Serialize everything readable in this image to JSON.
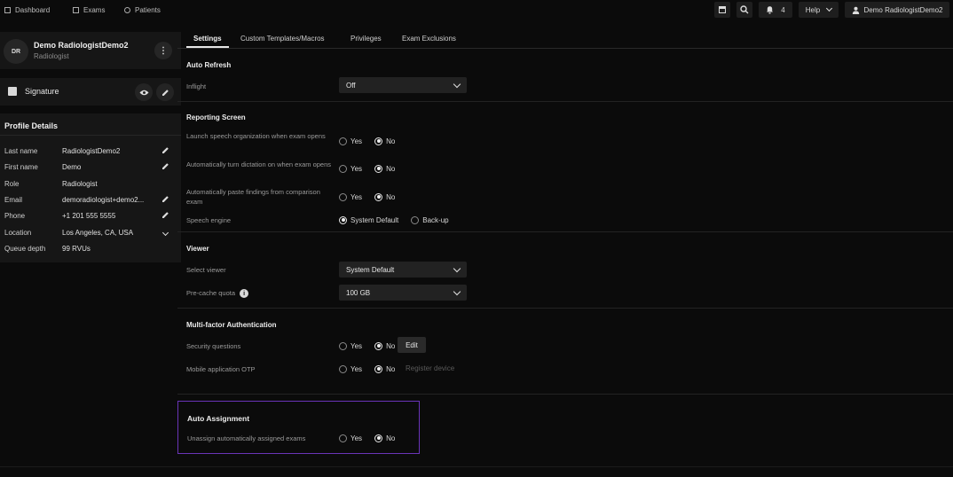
{
  "nav": {
    "dashboard": "Dashboard",
    "exams": "Exams",
    "patients": "Patients",
    "notifications_count": "4",
    "help": "Help",
    "user": "Demo RadiologistDemo2"
  },
  "profile": {
    "initials": "DR",
    "name": "Demo RadiologistDemo2",
    "role": "Radiologist",
    "signature_label": "Signature",
    "details_title": "Profile Details",
    "details": [
      {
        "label": "Last name",
        "value": "RadiologistDemo2",
        "action": "edit-icon"
      },
      {
        "label": "First name",
        "value": "Demo",
        "action": "edit-icon"
      },
      {
        "label": "Role",
        "value": "Radiologist",
        "action": ""
      },
      {
        "label": "Email",
        "value": "demoradiologist+demo2...",
        "action": "edit-icon"
      },
      {
        "label": "Phone",
        "value": "+1 201 555 5555",
        "action": "edit-icon"
      },
      {
        "label": "Location",
        "value": "Los Angeles, CA, USA",
        "action": "chevron-down-icon"
      },
      {
        "label": "Queue depth",
        "value": "99 RVUs",
        "action": ""
      }
    ]
  },
  "tabs": [
    "Settings",
    "Custom Templates/Macros",
    "Privileges",
    "Exam Exclusions"
  ],
  "active_tab": "Settings",
  "sections": {
    "auto_refresh": {
      "title": "Auto Refresh",
      "inflight_label": "Inflight",
      "inflight_value": "Off"
    },
    "reporting": {
      "title": "Reporting Screen",
      "speech_org_label": "Launch speech organization when exam opens",
      "dictation_label": "Automatically turn dictation on when exam opens",
      "paste_label": "Automatically paste findings from comparison exam",
      "engine_label": "Speech engine",
      "yes": "Yes",
      "no": "No",
      "engine_default": "System Default",
      "engine_backup": "Back-up"
    },
    "viewer": {
      "title": "Viewer",
      "select_label": "Select viewer",
      "select_value": "System Default",
      "quota_label": "Pre-cache quota",
      "quota_value": "100 GB"
    },
    "mfa": {
      "title": "Multi-factor Authentication",
      "security_label": "Security questions",
      "edit_label": "Edit",
      "otp_label": "Mobile application OTP",
      "register_label": "Register device"
    },
    "auto_assignment": {
      "title": "Auto Assignment",
      "unassign_label": "Unassign automatically assigned exams"
    }
  },
  "colors": {
    "background": "#0b0b0b",
    "panel": "#161616",
    "highlight_border": "#6a34b8"
  }
}
